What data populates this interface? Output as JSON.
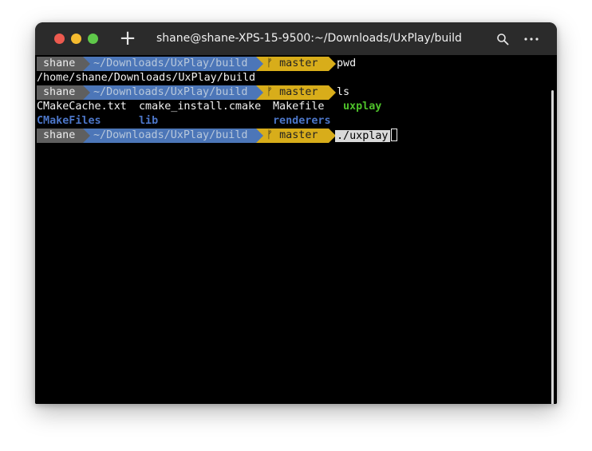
{
  "window": {
    "title": "shane@shane-XPS-15-9500:~/Downloads/UxPlay/build",
    "new_tab_symbol": "+",
    "controls": [
      "close",
      "minimize",
      "maximize"
    ],
    "icons": [
      "search-icon",
      "menu-icon"
    ]
  },
  "prompt": {
    "user": "shane",
    "directory": "~/Downloads/UxPlay/build",
    "git_symbol": "ᚠ",
    "branch": "master",
    "colors": {
      "user_bg": "#5f5f5f",
      "dir_bg": "#4c76b8",
      "git_bg": "#d8ad1a"
    }
  },
  "session": {
    "line1_command": "pwd",
    "line2_output": "/home/shane/Downloads/UxPlay/build",
    "line3_command": "ls",
    "ls_row1": [
      "CMakeCache.txt",
      "cmake_install.cmake",
      "Makefile",
      "uxplay"
    ],
    "ls_row2": [
      "CMakeFiles",
      "lib",
      "renderers"
    ],
    "line6_command": "./uxplay"
  },
  "colors": {
    "dir_text": "#4c76c8",
    "exec_text": "#4ec12a",
    "terminal_bg": "#000000"
  }
}
